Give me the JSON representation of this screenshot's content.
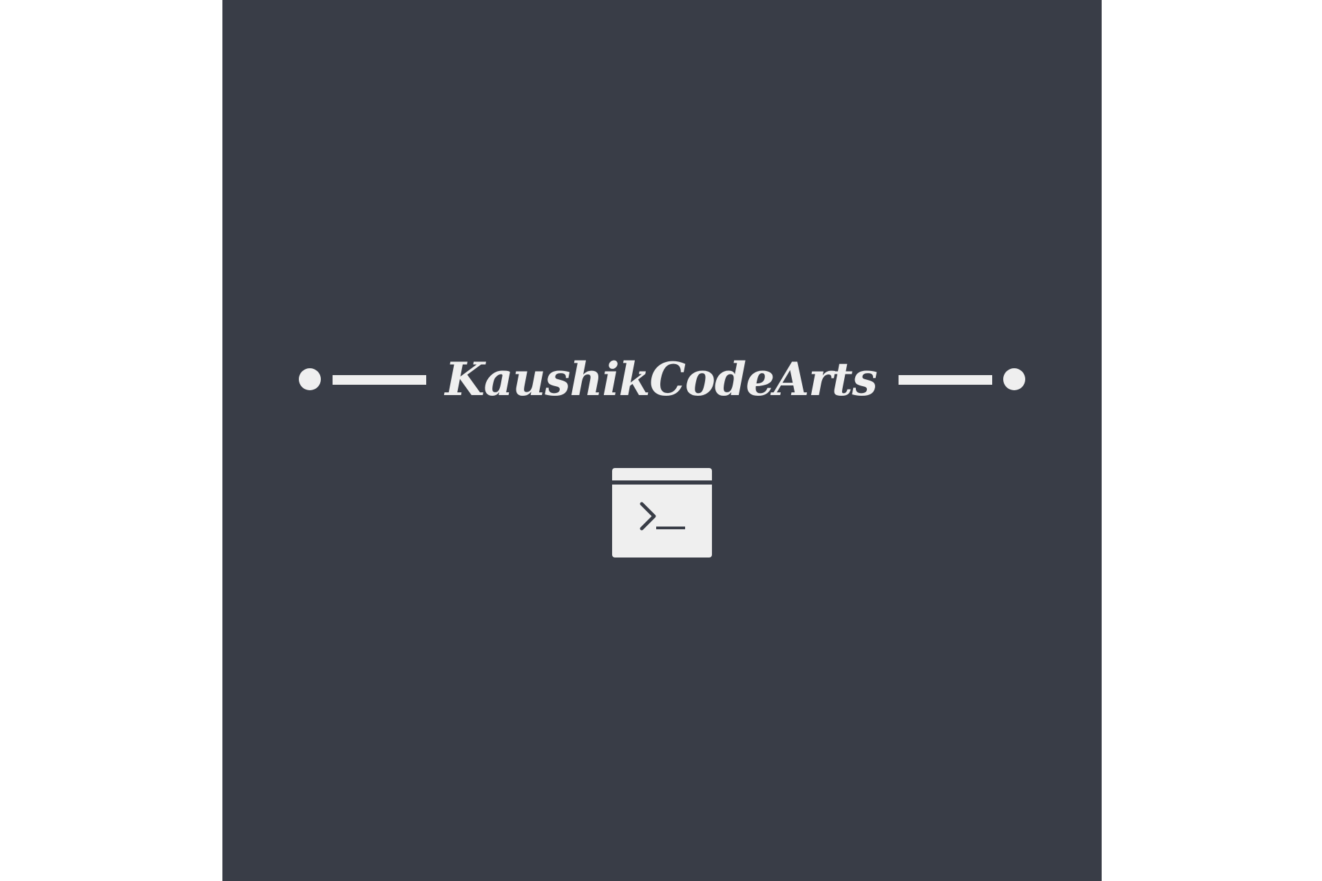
{
  "logo": {
    "brand_name": "KaushikCodeArts",
    "icon": "terminal-window-icon",
    "colors": {
      "background": "#393d47",
      "foreground": "#efefef",
      "page": "#ffffff"
    }
  }
}
